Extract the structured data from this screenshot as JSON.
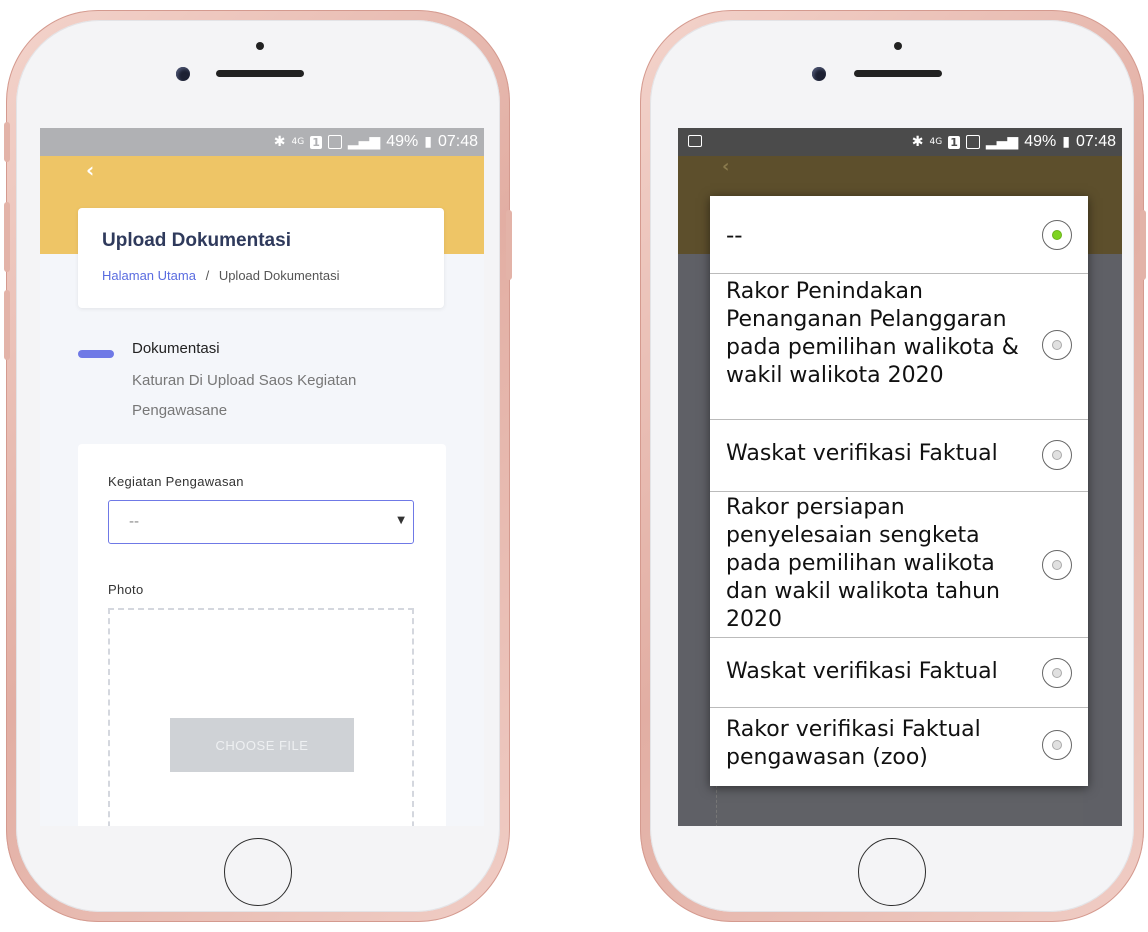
{
  "status_bar": {
    "bluetooth": "✱",
    "network": "4G",
    "sim": "1",
    "battery": "49%",
    "time": "07:48"
  },
  "left_screen": {
    "back_icon": "chevron-left-icon",
    "page_title": "Upload Dokumentasi",
    "breadcrumb_home": "Halaman Utama",
    "breadcrumb_sep": "/",
    "breadcrumb_current": "Upload Dokumentasi",
    "step_title": "Dokumentasi",
    "step_desc": "Katuran Di Upload Saos Kegiatan Pengawasane",
    "field_kegiatan_label": "Kegiatan Pengawasan",
    "field_kegiatan_value": "--",
    "field_photo_label": "Photo",
    "choose_file": "CHOOSE FILE"
  },
  "right_screen": {
    "options": [
      {
        "label": "--",
        "selected": true
      },
      {
        "label": "Rakor Penindakan Penanganan Pelanggaran pada pemilihan walikota & wakil walikota 2020",
        "selected": false
      },
      {
        "label": "Waskat verifikasi Faktual",
        "selected": false
      },
      {
        "label": "Rakor persiapan penyelesaian sengketa pada pemilihan walikota dan wakil walikota tahun 2020",
        "selected": false
      },
      {
        "label": "Waskat verifikasi Faktual",
        "selected": false
      },
      {
        "label": "Rakor verifikasi Faktual pengawasan (zoo)",
        "selected": false
      }
    ]
  },
  "colors": {
    "header_yellow": "#eec566",
    "accent_blue": "#6f79e6",
    "selected_green": "#7ed321"
  }
}
